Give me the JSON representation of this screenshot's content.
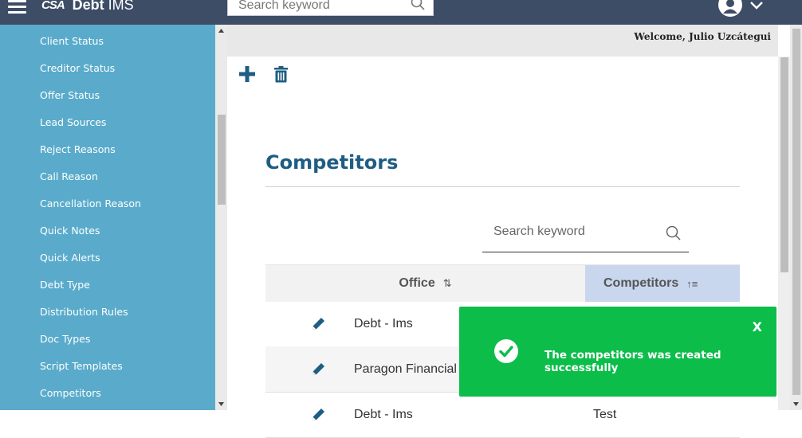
{
  "header": {
    "logo_mark": "CSA",
    "app_name_bold": "Debt",
    "app_name_rest": " IMS",
    "search_placeholder": "Search keyword"
  },
  "sidebar": {
    "items": [
      {
        "label": "Client Status"
      },
      {
        "label": "Creditor Status"
      },
      {
        "label": "Offer Status"
      },
      {
        "label": "Lead Sources"
      },
      {
        "label": "Reject Reasons"
      },
      {
        "label": "Call Reason"
      },
      {
        "label": "Cancellation Reason"
      },
      {
        "label": "Quick Notes"
      },
      {
        "label": "Quick Alerts"
      },
      {
        "label": "Debt Type"
      },
      {
        "label": "Distribution Rules"
      },
      {
        "label": "Doc Types"
      },
      {
        "label": "Script Templates"
      },
      {
        "label": "Competitors"
      }
    ]
  },
  "main": {
    "welcome": "Welcome, Julio Uzcátegui",
    "title": "Competitors",
    "search_placeholder": "Search keyword",
    "table": {
      "columns": [
        "Office",
        "Competitors"
      ],
      "rows": [
        {
          "office": "Debt - Ims",
          "competitor": ""
        },
        {
          "office": "Paragon Financial",
          "competitor": ""
        },
        {
          "office": "Debt - Ims",
          "competitor": "Test"
        }
      ]
    }
  },
  "toast": {
    "close_label": "X",
    "message": "The competitors was created successfully"
  },
  "colors": {
    "topbar": "#3d4d66",
    "sidebar": "#5aabcb",
    "title": "#1f5d83",
    "toast": "#0cbd4a",
    "accent": "#1f5d83"
  },
  "icons": {
    "menu": "hamburger-icon",
    "search": "search-icon",
    "user": "user-icon",
    "add": "plus-icon",
    "delete": "trash-icon",
    "edit": "pencil-icon",
    "success": "check-circle-icon"
  }
}
